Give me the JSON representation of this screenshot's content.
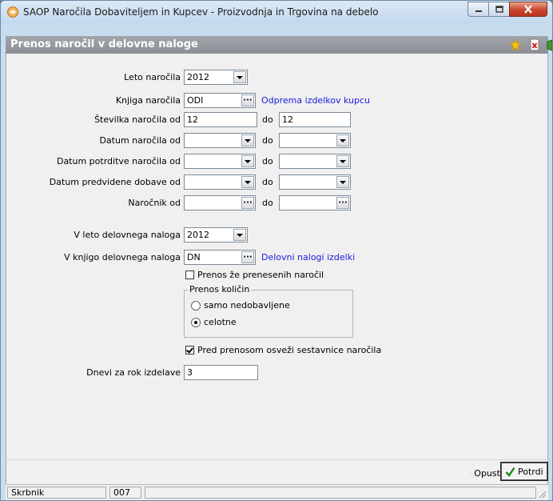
{
  "window": {
    "title": "SAOP   Naročila Dobaviteljem in Kupcev - Proizvodnja in Trgovina na debelo"
  },
  "form": {
    "title": "Prenos naročil v delovne naloge"
  },
  "fields": {
    "leto_narocila": {
      "label": "Leto naročila",
      "value": "2012"
    },
    "knjiga_narocila": {
      "label": "Knjiga naročila",
      "value": "ODI",
      "description": "Odprema izdelkov kupcu"
    },
    "stevilka_od": {
      "label": "Številka naročila od",
      "value": "12"
    },
    "stevilka_do": {
      "label": "do",
      "value": "12"
    },
    "datum_narocila": {
      "label": "Datum naročila od",
      "to_label": "do",
      "from": "",
      "to": ""
    },
    "datum_potrditve": {
      "label": "Datum potrditve naročila od",
      "to_label": "do",
      "from": "",
      "to": ""
    },
    "datum_dobave": {
      "label": "Datum predvidene dobave od",
      "to_label": "do",
      "from": "",
      "to": ""
    },
    "narocnik": {
      "label": "Naročnik od",
      "to_label": "do",
      "from": "",
      "to": ""
    },
    "leto_naloga": {
      "label": "V leto delovnega naloga",
      "value": "2012"
    },
    "knjiga_naloga": {
      "label": "V knjigo delovnega naloga",
      "value": "DN",
      "description": "Delovni nalogi  izdelki"
    },
    "prenos_prenesenih": {
      "label": "Prenos že prenesenih naročil",
      "checked": false
    },
    "prenos_kolicin": {
      "title": "Prenos količin",
      "options": [
        {
          "label": "samo nedobavljene",
          "selected": false
        },
        {
          "label": "celotne",
          "selected": true
        }
      ]
    },
    "osvezi_sestavnice": {
      "label": "Pred prenosom osveži sestavnice naročila",
      "checked": true
    },
    "dnevi_rok": {
      "label": "Dnevi za rok izdelave",
      "value": "3"
    }
  },
  "buttons": {
    "cancel": "Opusti",
    "confirm": "Potrdi"
  },
  "status": {
    "user": "Skrbnik",
    "code": "007",
    "extra": ""
  },
  "colors": {
    "link": "#1a1ae0",
    "header_bg": "#8b9096",
    "confirm_icon": "#1a8a1a",
    "cancel_icon": "#d42020"
  }
}
